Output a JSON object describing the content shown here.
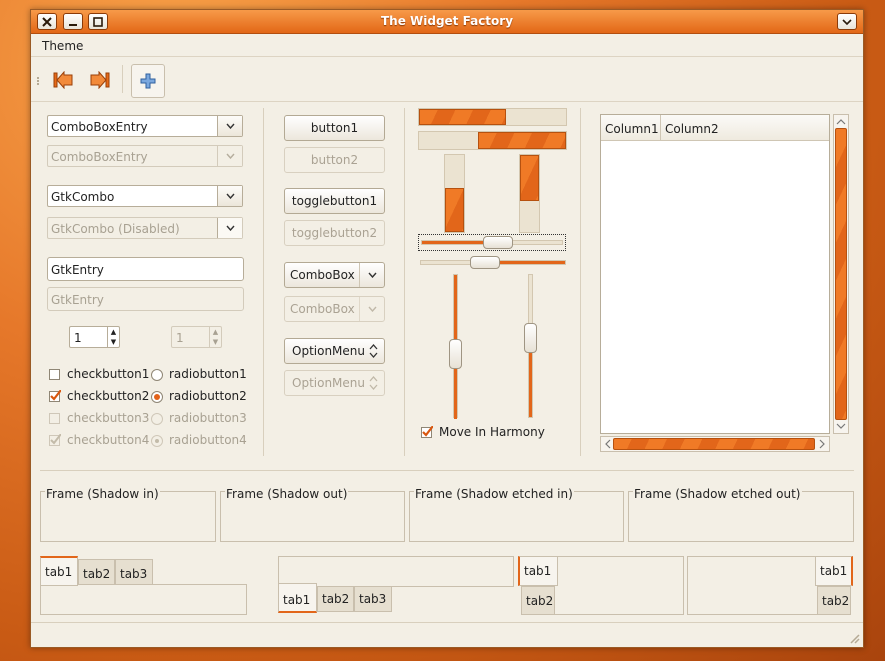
{
  "window": {
    "title": "The Widget Factory"
  },
  "menubar": {
    "items": [
      "Theme"
    ]
  },
  "toolbar": {
    "icons": [
      "go-first-icon",
      "go-last-icon",
      "add-icon"
    ]
  },
  "combos": {
    "entry1": "ComboBoxEntry",
    "entry1_disabled": "ComboBoxEntry",
    "gtkcombo": "GtkCombo",
    "gtkcombo_disabled": "GtkCombo (Disabled)"
  },
  "entries": {
    "entry": "GtkEntry",
    "entry_disabled": "GtkEntry"
  },
  "spins": {
    "value": "1",
    "value_disabled": "1"
  },
  "checks": [
    {
      "label": "checkbutton1",
      "checked": false,
      "disabled": false
    },
    {
      "label": "checkbutton2",
      "checked": true,
      "disabled": false
    },
    {
      "label": "checkbutton3",
      "checked": false,
      "disabled": true
    },
    {
      "label": "checkbutton4",
      "checked": true,
      "disabled": true
    }
  ],
  "radios": [
    {
      "label": "radiobutton1",
      "selected": false,
      "disabled": false
    },
    {
      "label": "radiobutton2",
      "selected": true,
      "disabled": false
    },
    {
      "label": "radiobutton3",
      "selected": false,
      "disabled": true
    },
    {
      "label": "radiobutton4",
      "selected": true,
      "disabled": true
    }
  ],
  "buttons": {
    "button1": "button1",
    "button2": "button2",
    "toggle1": "togglebutton1",
    "toggle2": "togglebutton2",
    "combobox1": "ComboBox",
    "combobox2": "ComboBox",
    "option1": "OptionMenu",
    "option2": "OptionMenu"
  },
  "progress": {
    "h1": 0.59,
    "h2": 0.6,
    "v1": 0.57,
    "v2": 0.6
  },
  "scales": {
    "h1": 0.55,
    "h2": 0.43,
    "v1": 0.57,
    "v2": 0.43
  },
  "harmony": {
    "label": "Move In Harmony",
    "checked": true
  },
  "tree": {
    "columns": [
      "Column1",
      "Column2"
    ]
  },
  "frames": [
    "Frame (Shadow in)",
    "Frame (Shadow out)",
    "Frame (Shadow etched in)",
    "Frame (Shadow etched out)"
  ],
  "notebooks": {
    "top": [
      "tab1",
      "tab2",
      "tab3"
    ],
    "bottom": [
      "tab1",
      "tab2",
      "tab3"
    ],
    "left": [
      "tab1",
      "tab2"
    ],
    "right": [
      "tab1",
      "tab2"
    ]
  },
  "colors": {
    "accent": "#e96c1e",
    "window_bg": "#f3efe5"
  }
}
